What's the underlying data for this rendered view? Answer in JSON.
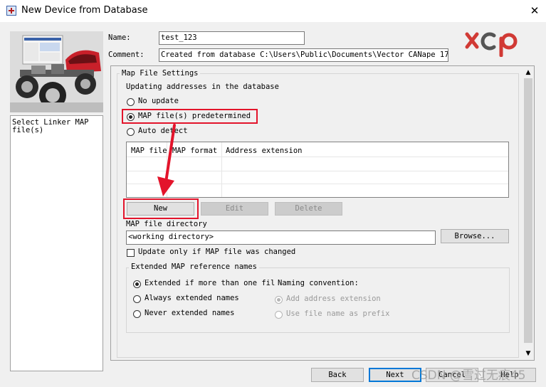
{
  "window": {
    "title": "New Device from Database",
    "close_glyph": "✕"
  },
  "sidebar": {
    "step_label": "Select Linker MAP file(s)"
  },
  "header": {
    "name_label": "Name:",
    "name_value": "test_123",
    "comment_label": "Comment:",
    "comment_value": "Created from database C:\\Users\\Public\\Documents\\Vector CANape 17\\Pr"
  },
  "map_settings": {
    "group_title": "Map File Settings",
    "updating_label": "Updating addresses in the database",
    "options": [
      {
        "label": "No update",
        "selected": false
      },
      {
        "label": "MAP file(s) predetermined",
        "selected": true
      },
      {
        "label": "Auto detect",
        "selected": false
      }
    ],
    "table_columns": [
      "MAP file",
      "MAP format",
      "Address extension"
    ],
    "new_button": "New",
    "edit_button": "Edit",
    "delete_button": "Delete",
    "directory_label": "MAP file directory",
    "directory_value": "<working directory>",
    "browse_button": "Browse...",
    "update_only_label": "Update only if MAP file was changed"
  },
  "extended_names": {
    "group_title": "Extended MAP reference names",
    "options": [
      {
        "label": "Extended if more than one fil",
        "selected": true
      },
      {
        "label": "Always extended names",
        "selected": false
      },
      {
        "label": "Never extended names",
        "selected": false
      }
    ],
    "naming_label": "Naming convention:",
    "naming_options": [
      {
        "label": "Add address extension",
        "selected": true
      },
      {
        "label": "Use file name as prefix",
        "selected": false
      }
    ]
  },
  "footer": {
    "back_button": "Back",
    "next_button": "Next",
    "cancel_button": "Cancel",
    "help_button": "Help"
  },
  "watermark": "CSDN @雪过无痕45",
  "colors": {
    "highlight_red": "#e3142b",
    "logo_red": "#d13a35",
    "logo_gray": "#555555"
  }
}
